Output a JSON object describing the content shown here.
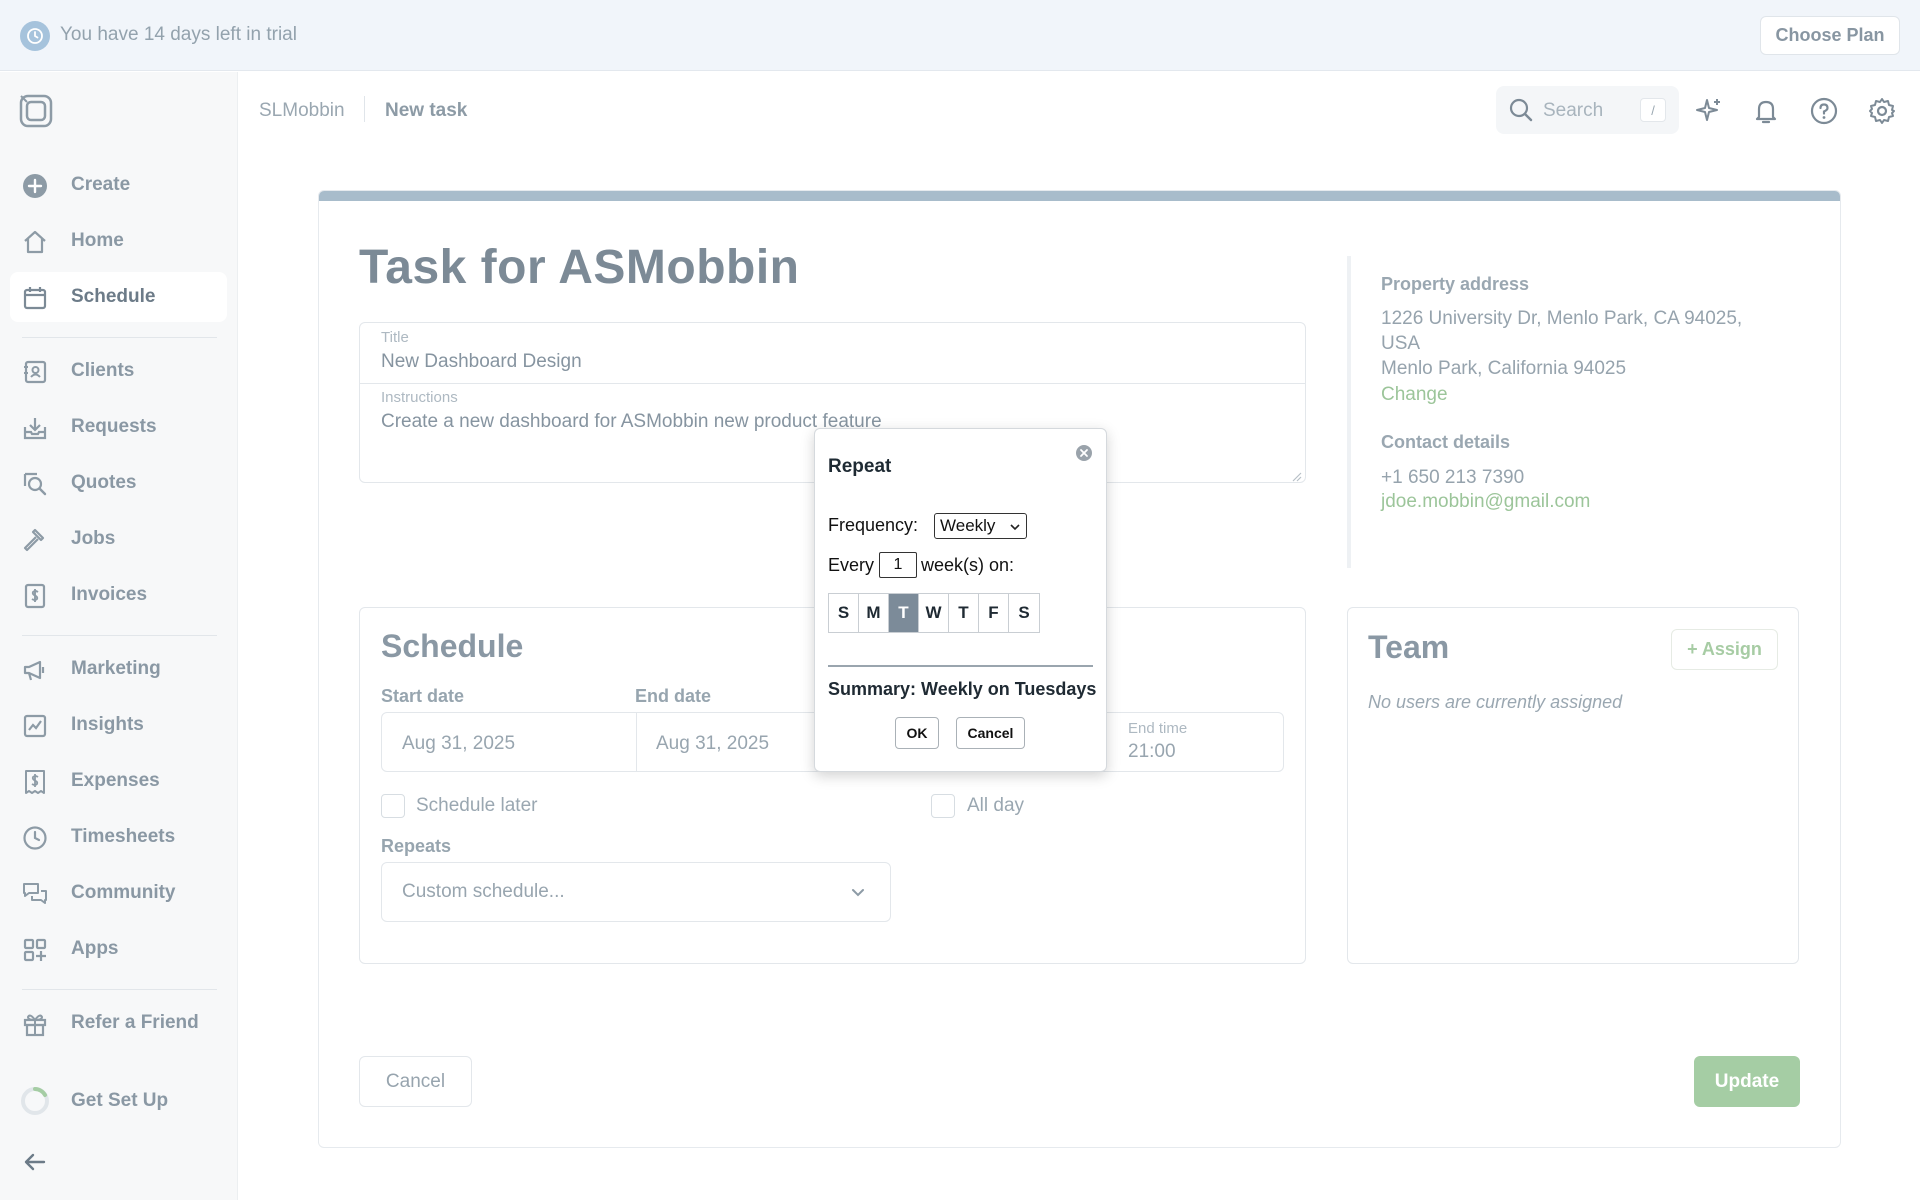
{
  "trial": {
    "message": "You have 14 days left in trial",
    "choose_plan_label": "Choose Plan"
  },
  "sidebar": {
    "items": [
      {
        "label": "Create",
        "icon": "plus-circle-icon"
      },
      {
        "label": "Home",
        "icon": "home-icon"
      },
      {
        "label": "Schedule",
        "icon": "calendar-icon",
        "active": true
      },
      {
        "label": "Clients",
        "icon": "contact-book-icon"
      },
      {
        "label": "Requests",
        "icon": "inbox-download-icon"
      },
      {
        "label": "Quotes",
        "icon": "quote-search-icon"
      },
      {
        "label": "Jobs",
        "icon": "hammer-icon"
      },
      {
        "label": "Invoices",
        "icon": "invoice-dollar-icon"
      },
      {
        "label": "Marketing",
        "icon": "megaphone-icon"
      },
      {
        "label": "Insights",
        "icon": "chart-icon"
      },
      {
        "label": "Expenses",
        "icon": "receipt-dollar-icon"
      },
      {
        "label": "Timesheets",
        "icon": "clock-icon"
      },
      {
        "label": "Community",
        "icon": "chat-bubbles-icon"
      },
      {
        "label": "Apps",
        "icon": "apps-grid-icon"
      },
      {
        "label": "Refer a Friend",
        "icon": "gift-icon"
      },
      {
        "label": "Get Set Up",
        "icon": "progress-ring-icon"
      }
    ]
  },
  "header": {
    "breadcrumb_company": "SLMobbin",
    "breadcrumb_page": "New task",
    "search_placeholder": "Search",
    "search_shortcut": "/"
  },
  "task": {
    "heading": "Task for ASMobbin",
    "title_label": "Title",
    "title_value": "New Dashboard Design",
    "instructions_label": "Instructions",
    "instructions_value": "Create a new dashboard for ASMobbin new product feature"
  },
  "property": {
    "heading": "Property address",
    "line1": "1226 University Dr, Menlo Park, CA 94025,",
    "line2": "USA",
    "line3": "Menlo Park, California 94025",
    "change_label": "Change"
  },
  "contact": {
    "heading": "Contact details",
    "phone": "+1 650 213 7390",
    "email": "jdoe.mobbin@gmail.com"
  },
  "schedule": {
    "heading": "Schedule",
    "start_date_label": "Start date",
    "start_date": "Aug 31, 2025",
    "end_date_label": "End date",
    "end_date": "Aug 31, 2025",
    "end_time_label": "End time",
    "end_time": "21:00",
    "schedule_later_label": "Schedule later",
    "all_day_label": "All day",
    "repeats_label": "Repeats",
    "repeats_value": "Custom schedule..."
  },
  "team": {
    "heading": "Team",
    "assign_label": "+ Assign",
    "empty_text": "No users are currently assigned"
  },
  "footer": {
    "cancel_label": "Cancel",
    "update_label": "Update"
  },
  "repeat_dialog": {
    "title": "Repeat",
    "frequency_label": "Frequency:",
    "frequency_value": "Weekly",
    "every_label": "Every",
    "every_value": "1",
    "unit_label": "week(s) on:",
    "days": [
      {
        "label": "S",
        "selected": false
      },
      {
        "label": "M",
        "selected": false
      },
      {
        "label": "T",
        "selected": true
      },
      {
        "label": "W",
        "selected": false
      },
      {
        "label": "T",
        "selected": false
      },
      {
        "label": "F",
        "selected": false
      },
      {
        "label": "S",
        "selected": false
      }
    ],
    "summary": "Summary: Weekly on Tuesdays",
    "ok_label": "OK",
    "cancel_label": "Cancel"
  },
  "colors": {
    "accent_green": "#a5cda4",
    "top_bar": "#a8bccb",
    "selected_day": "#7c8b99"
  }
}
